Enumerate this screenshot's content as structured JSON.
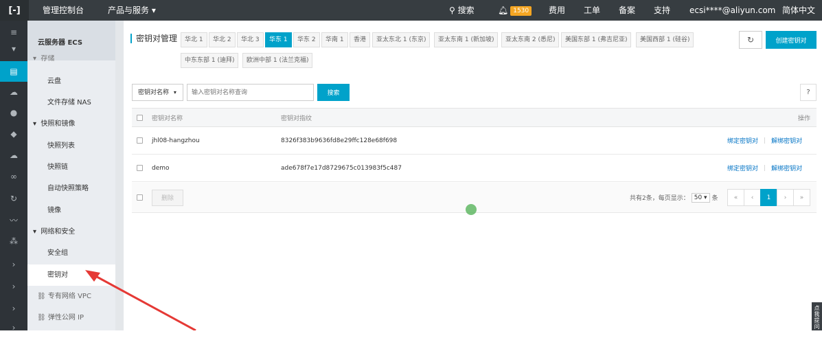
{
  "topbar": {
    "logo": "[-]",
    "console": "管理控制台",
    "products": "产品与服务 ▾",
    "search": "搜索",
    "notifications": "1530",
    "billing": "费用",
    "ticket": "工单",
    "icp": "备案",
    "support": "支持",
    "account": "ecsi****@aliyun.com",
    "language": "简体中文"
  },
  "sidebar": {
    "title": "云服务器 ECS",
    "items": [
      {
        "label": "存储",
        "type": "group-partial"
      },
      {
        "label": "云盘",
        "type": "item"
      },
      {
        "label": "文件存储 NAS",
        "type": "item"
      },
      {
        "label": "快照和镜像",
        "type": "group"
      },
      {
        "label": "快照列表",
        "type": "item"
      },
      {
        "label": "快照链",
        "type": "item"
      },
      {
        "label": "自动快照策略",
        "type": "item"
      },
      {
        "label": "镜像",
        "type": "item"
      },
      {
        "label": "网络和安全",
        "type": "group"
      },
      {
        "label": "安全组",
        "type": "item"
      },
      {
        "label": "密钥对",
        "type": "selected"
      },
      {
        "label": "专有网络 VPC",
        "type": "link"
      },
      {
        "label": "弹性公网 IP",
        "type": "link"
      }
    ]
  },
  "page": {
    "title": "密钥对管理",
    "regions_row1": [
      "华北 1",
      "华北 2",
      "华北 3",
      "华东 1",
      "华东 2",
      "华南 1",
      "香港",
      "亚太东北 1 (东京)",
      "亚太东南 1 (新加坡)",
      "亚太东南 2 (悉尼)",
      "美国东部 1 (弗吉尼亚)",
      "美国西部 1 (硅谷)"
    ],
    "regions_row2": [
      "中东东部 1 (迪拜)",
      "欧洲中部 1 (法兰克福)"
    ],
    "active_region": "华东 1",
    "refresh_icon": "↻",
    "create_button": "创建密钥对"
  },
  "search": {
    "select_value": "密钥对名称",
    "placeholder": "输入密钥对名称查询",
    "button": "搜索",
    "help": "?"
  },
  "table": {
    "headers": {
      "name": "密钥对名称",
      "fingerprint": "密钥对指纹",
      "actions": "操作"
    },
    "rows": [
      {
        "name": "jhl08-hangzhou",
        "fingerprint": "8326f383b9636fd8e29ffc128e68f698",
        "bind": "绑定密钥对",
        "unbind": "解绑密钥对"
      },
      {
        "name": "demo",
        "fingerprint": "ade678f7e17d8729675c013983f5c487",
        "bind": "绑定密钥对",
        "unbind": "解绑密钥对"
      }
    ],
    "footer": {
      "delete": "删除",
      "total": "共有2条，每页显示：",
      "page_size": "50 ▾",
      "unit": "条",
      "pages": [
        "«",
        "‹",
        "1",
        "›",
        "»"
      ],
      "current_page": "1"
    }
  },
  "feedback": "点我提问"
}
